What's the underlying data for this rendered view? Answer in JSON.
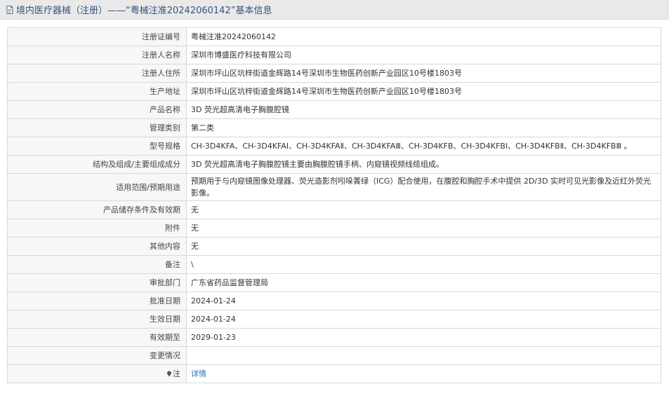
{
  "header": {
    "title": "境内医疗器械（注册）——“粤械注准20242060142”基本信息",
    "icon": "document-icon"
  },
  "rows": [
    {
      "label": "注册证编号",
      "value": "粤械注准20242060142"
    },
    {
      "label": "注册人名称",
      "value": "深圳市博盛医疗科技有限公司"
    },
    {
      "label": "注册人住所",
      "value": "深圳市坪山区坑梓街道金辉路14号深圳市生物医药创新产业园区10号楼1803号"
    },
    {
      "label": "生产地址",
      "value": "深圳市坪山区坑梓街道金辉路14号深圳市生物医药创新产业园区10号楼1803号"
    },
    {
      "label": "产品名称",
      "value": "3D 荧光超高清电子胸腹腔镜"
    },
    {
      "label": "管理类别",
      "value": "第二类"
    },
    {
      "label": "型号规格",
      "value": "CH-3D4KFA、CH-3D4KFAⅠ、CH-3D4KFAⅡ、CH-3D4KFAⅢ、CH-3D4KFB、CH-3D4KFBⅠ、CH-3D4KFBⅡ、CH-3D4KFBⅢ 。"
    },
    {
      "label": "结构及组成/主要组成成分",
      "value": "3D 荧光超高清电子胸腹腔镜主要由胸腹腔镜手柄、内窥镜视频线缆组成。"
    },
    {
      "label": "适用范围/预期用途",
      "value": "预期用于与内窥镜图像处理器、荧光造影剂吲哚菁绿（ICG）配合使用，在腹腔和胸腔手术中提供 2D/3D 实时可见光影像及近红外荧光影像。"
    },
    {
      "label": "产品储存条件及有效期",
      "value": "无"
    },
    {
      "label": "附件",
      "value": "无"
    },
    {
      "label": "其他内容",
      "value": "无"
    },
    {
      "label": "备注",
      "value": "\\"
    },
    {
      "label": "审批部门",
      "value": "广东省药品监督管理局"
    },
    {
      "label": "批准日期",
      "value": "2024-01-24"
    },
    {
      "label": "生效日期",
      "value": "2024-01-24"
    },
    {
      "label": "有效期至",
      "value": "2029-01-23"
    },
    {
      "label": "变更情况",
      "value": ""
    }
  ],
  "note_row": {
    "label": "注",
    "icon": "pin-icon",
    "link_text": "详情"
  },
  "colors": {
    "title_text": "#33547a",
    "title_bg": "#e9e9e9",
    "label_bg": "#f7f7f7",
    "border": "#d8d8d8",
    "link": "#2a6fb5"
  }
}
